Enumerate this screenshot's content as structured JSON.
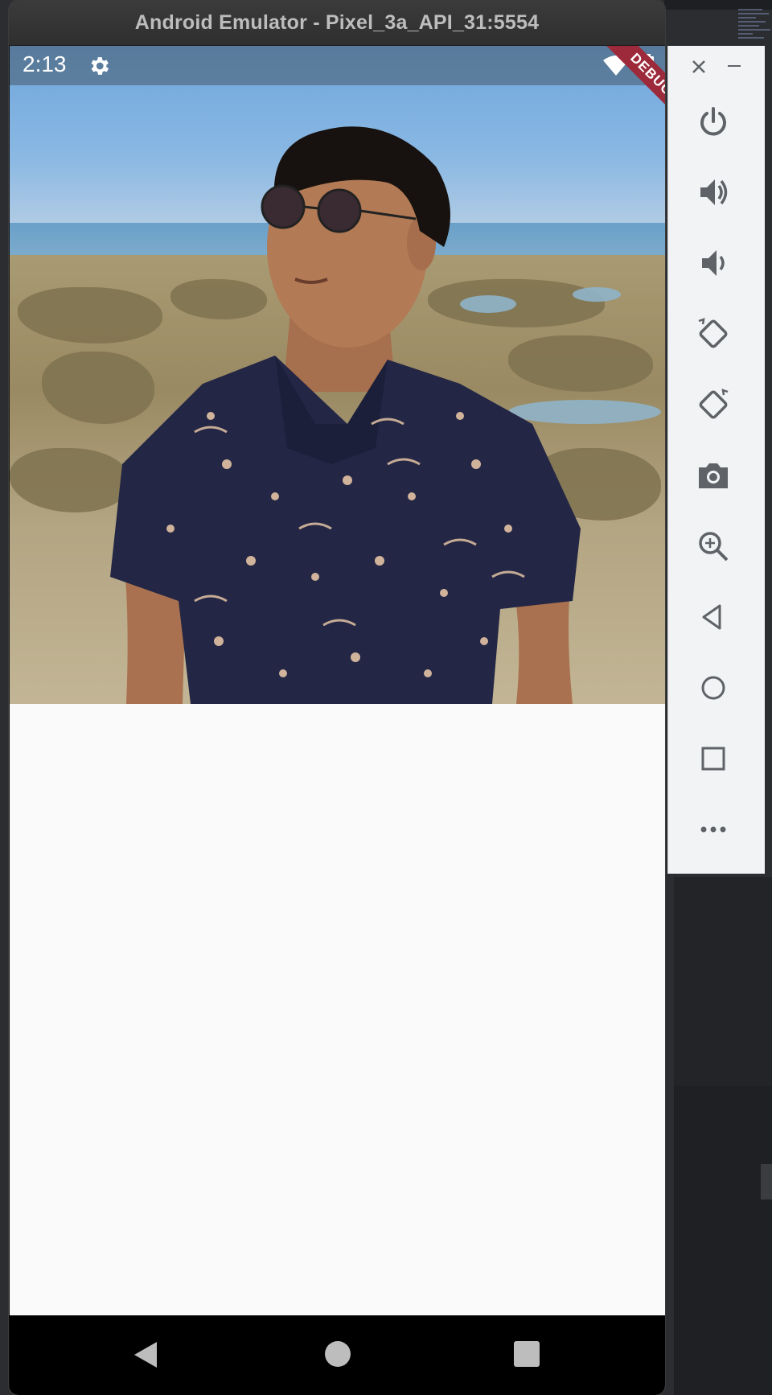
{
  "window": {
    "title": "Android Emulator - Pixel_3a_API_31:5554"
  },
  "status_bar": {
    "time": "2:13"
  },
  "debug_banner": {
    "label": "DEBUG"
  },
  "colors": {
    "ribbon": "#9c2a3a",
    "toolbar_icon": "#5f6368",
    "navbar": "#000000"
  },
  "toolbar": {
    "buttons": [
      {
        "icon": "power-icon"
      },
      {
        "icon": "volume-up-icon"
      },
      {
        "icon": "volume-down-icon"
      },
      {
        "icon": "rotate-left-icon"
      },
      {
        "icon": "rotate-right-icon"
      },
      {
        "icon": "camera-icon"
      },
      {
        "icon": "zoom-in-icon"
      },
      {
        "icon": "back-icon"
      },
      {
        "icon": "home-icon"
      },
      {
        "icon": "overview-icon"
      },
      {
        "icon": "more-icon"
      }
    ]
  }
}
